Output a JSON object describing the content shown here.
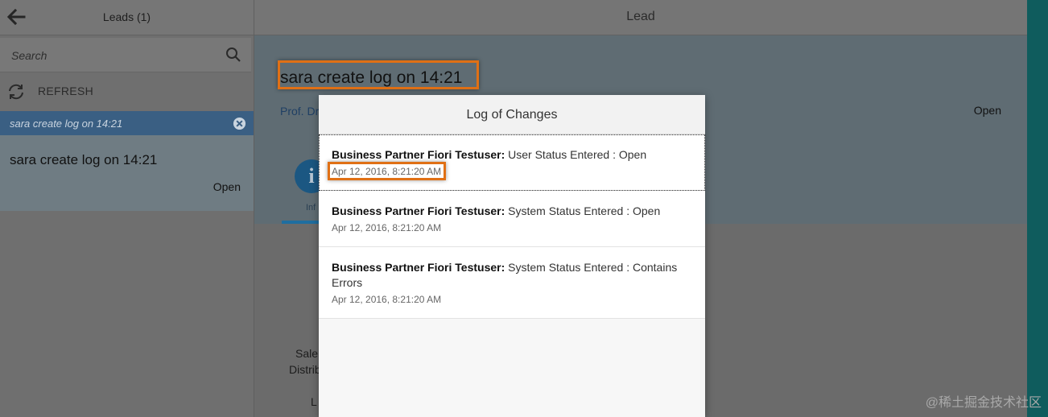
{
  "master": {
    "title": "Leads (1)",
    "search_placeholder": "Search",
    "refresh_label": "REFRESH",
    "selected_item_label": "sara create log on 14:21",
    "item": {
      "title": "sara create log on 14:21",
      "status": "Open"
    }
  },
  "detail": {
    "title": "Lead",
    "object_title": "sara create log on 14:21",
    "object_sub": "Prof. Dr",
    "object_status": "Open",
    "info_tab_letter": "i",
    "info_tab_label": "Inf",
    "form_labels": [
      "Sale",
      "Distrib",
      "L"
    ]
  },
  "dialog": {
    "title": "Log of Changes",
    "entries": [
      {
        "author": "Business Partner Fiori Testuser:",
        "change": " User Status Entered : Open",
        "date": "Apr 12, 2016, 8:21:20 AM"
      },
      {
        "author": "Business Partner Fiori Testuser:",
        "change": " System Status Entered : Open",
        "date": "Apr 12, 2016, 8:21:20 AM"
      },
      {
        "author": "Business Partner Fiori Testuser:",
        "change": " System Status Entered : Contains Errors",
        "date": "Apr 12, 2016, 8:21:20 AM"
      }
    ]
  },
  "colors": {
    "highlight": "#e07015",
    "selected": "#3a5f83",
    "accent": "#1b5782"
  },
  "watermark": "@稀土掘金技术社区"
}
